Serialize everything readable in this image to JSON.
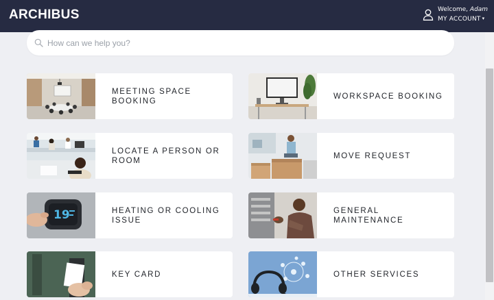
{
  "header": {
    "brand": "ARCHIBUS",
    "welcome_prefix": "Welcome,",
    "user_name": "Adam",
    "account_label": "MY ACCOUNT",
    "account_caret": "▾",
    "user_icon": "user-icon",
    "background": "#262b42"
  },
  "search": {
    "placeholder": "How can we help you?",
    "value": "",
    "icon": "search-icon"
  },
  "services": [
    {
      "label": "MEETING SPACE\nBOOKING",
      "image": "meeting-room-photo"
    },
    {
      "label": "WORKSPACE BOOKING",
      "image": "workspace-desk-photo"
    },
    {
      "label": "LOCATE A PERSON OR\nROOM",
      "image": "office-people-photo"
    },
    {
      "label": "MOVE REQUEST",
      "image": "moving-boxes-photo"
    },
    {
      "label": "HEATING OR COOLING\nISSUE",
      "image": "thermostat-photo"
    },
    {
      "label": "GENERAL MAINTENANCE",
      "image": "maintenance-worker-photo"
    },
    {
      "label": "KEY CARD",
      "image": "key-card-photo"
    },
    {
      "label": "OTHER SERVICES",
      "image": "headset-photo"
    }
  ],
  "thermostat_reading": "19",
  "colors": {
    "page_background": "#eeeff3",
    "tile_background": "#ffffff",
    "text": "#1f2228"
  }
}
